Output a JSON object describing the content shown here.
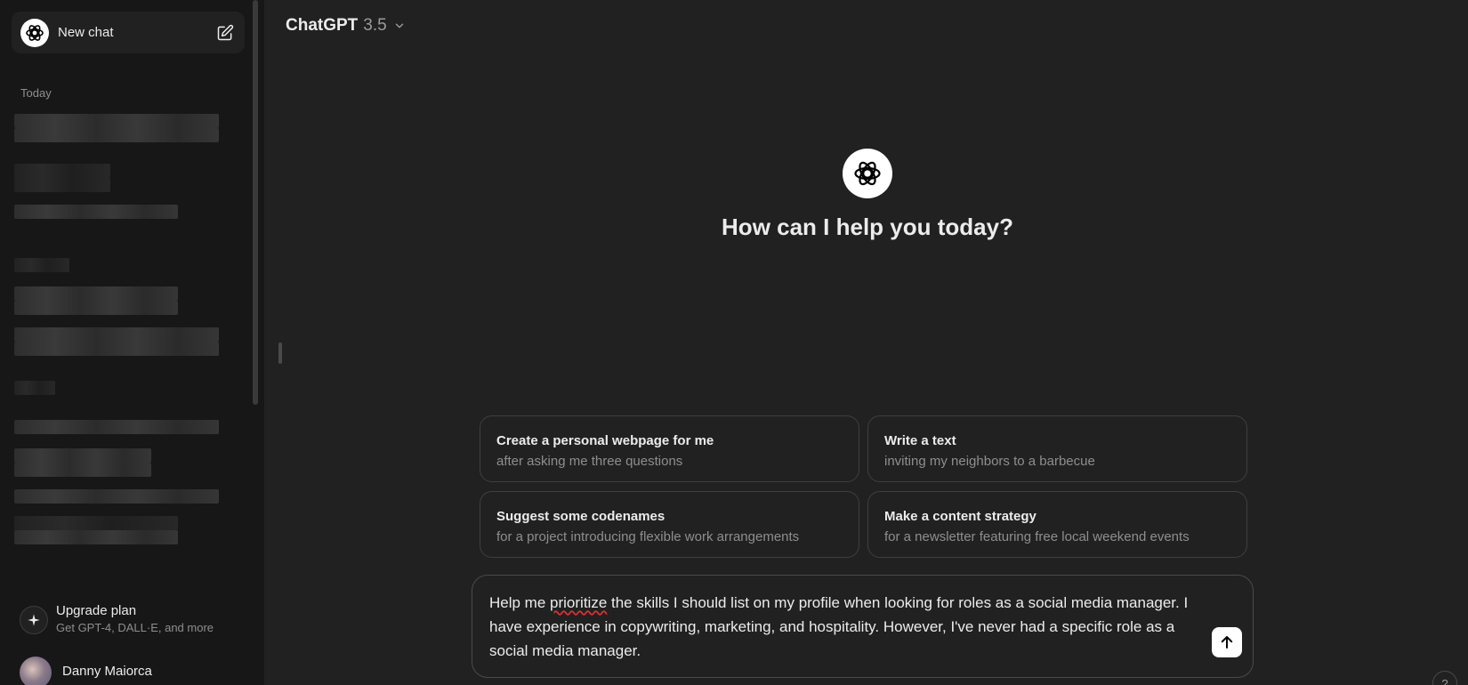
{
  "sidebar": {
    "new_chat_label": "New chat",
    "section_label": "Today",
    "history_count_note": "",
    "upgrade": {
      "title": "Upgrade plan",
      "subtitle": "Get GPT-4, DALL·E, and more"
    },
    "user": {
      "name": "Danny Maiorca"
    }
  },
  "header": {
    "model_name": "ChatGPT",
    "model_version": "3.5"
  },
  "hero": {
    "title": "How can I help you today?"
  },
  "suggestions": [
    {
      "title": "Create a personal webpage for me",
      "subtitle": "after asking me three questions"
    },
    {
      "title": "Write a text",
      "subtitle": "inviting my neighbors to a barbecue"
    },
    {
      "title": "Suggest some codenames",
      "subtitle": "for a project introducing flexible work arrangements"
    },
    {
      "title": "Make a content strategy",
      "subtitle": "for a newsletter featuring free local weekend events"
    }
  ],
  "composer": {
    "text_before": "Help me ",
    "misspelled": "prioritize",
    "text_after": " the skills I should list on my profile when looking for roles as a social media manager. I have experience in copywriting, marketing, and hospitality. However, I've never had a specific role as a social media manager."
  },
  "help_label": "?",
  "colors": {
    "background": "#212121",
    "sidebar": "#171717",
    "text": "#ececec",
    "muted": "#8e8e8e",
    "border": "#3f3f3f"
  },
  "icons": {
    "logo": "openai-logo-icon",
    "edit": "edit-icon",
    "chevron": "chevron-down-icon",
    "sparkle": "sparkle-icon",
    "send": "arrow-up-icon"
  }
}
